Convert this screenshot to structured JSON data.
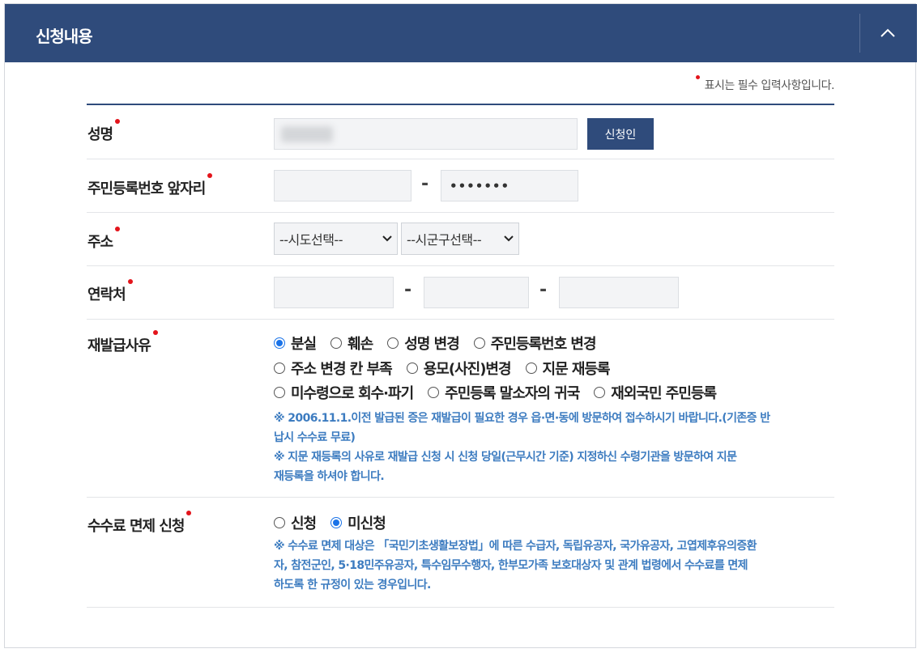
{
  "panel": {
    "title": "신청내용"
  },
  "required_note": "표시는 필수 입력사항입니다.",
  "fields": {
    "name": {
      "label": "성명",
      "button": "신청인"
    },
    "rrn": {
      "label": "주민등록번호 앞자리",
      "back_value": "•••••••",
      "separator": "-"
    },
    "address": {
      "label": "주소",
      "sido": "--시도선택--",
      "sigungu": "--시군구선택--"
    },
    "contact": {
      "label": "연락처",
      "separator": "-"
    },
    "reason": {
      "label": "재발급사유",
      "options": [
        "분실",
        "훼손",
        "성명 변경",
        "주민등록번호 변경",
        "주소 변경 칸 부족",
        "용모(사진)변경",
        "지문 재등록",
        "미수령으로 회수·파기",
        "주민등록 말소자의 귀국",
        "재외국민 주민등록"
      ],
      "selected": "분실",
      "note1_line1": "※ 2006.11.1.이전 발급된 증은 재발급이 필요한 경우 읍·면·동에 방문하여 접수하시기 바랍니다.(기존증 반",
      "note1_line2": "납시 수수료 무료)",
      "note2_line1": "※ 지문 재등록의 사유로 재발급 신청 시 신청 당일(근무시간 기준) 지정하신 수령기관을 방문하여 지문",
      "note2_line2": "재등록을 하셔야 합니다."
    },
    "fee": {
      "label": "수수료 면제 신청",
      "options": [
        "신청",
        "미신청"
      ],
      "selected": "미신청",
      "note_line1": "※ 수수료 면제 대상은 「국민기초생활보장법」에 따른 수급자, 독립유공자, 국가유공자, 고엽제후유의증환",
      "note_line2": "자, 참전군인, 5·18민주유공자, 특수임무수행자, 한부모가족 보호대상자 및 관계 법령에서 수수료를 면제",
      "note_line3": "하도록 한 규정이 있는 경우입니다."
    }
  },
  "colors": {
    "header": "#2f4b7b",
    "required_dot": "#e3141b",
    "note": "#3d7cc0",
    "radio_checked": "#1a73e8"
  }
}
